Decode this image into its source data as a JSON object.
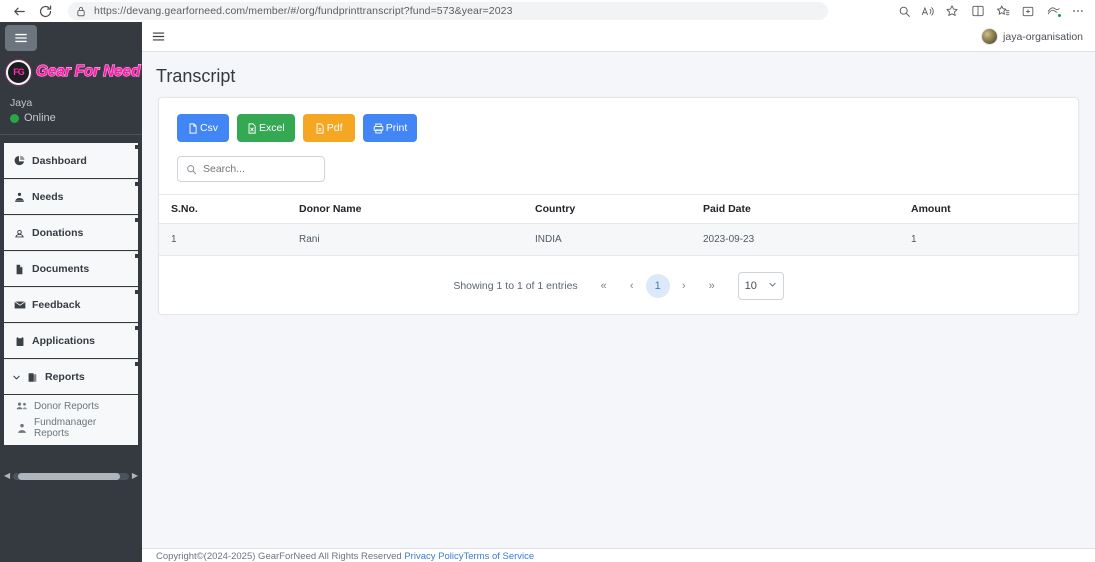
{
  "browser": {
    "url": "https://devang.gearforneed.com/member/#/org/fundprinttranscript?fund=573&year=2023",
    "back_label": "Back",
    "reload_label": "Refresh",
    "lock_label": "Site information",
    "icons": {
      "search": "search-icon",
      "read_aloud": "read-aloud-icon",
      "favorite": "favorite-star-icon",
      "split_screen": "split-screen-icon",
      "favorites_bar": "favorites-icon",
      "collections": "collections-icon",
      "browser_essentials": "browser-essentials-icon",
      "settings_more": "more-options-icon"
    }
  },
  "sidebar": {
    "toggle_label": "Toggle navigation",
    "brand": {
      "badge_text": "FG",
      "name": "Gear For Need"
    },
    "user": {
      "name": "Jaya",
      "status": "Online"
    },
    "items": [
      {
        "label": "Dashboard",
        "icon": "dashboard-pie-icon"
      },
      {
        "label": "Needs",
        "icon": "needs-hand-icon"
      },
      {
        "label": "Donations",
        "icon": "donations-icon"
      },
      {
        "label": "Documents",
        "icon": "document-icon"
      },
      {
        "label": "Feedback",
        "icon": "envelope-icon"
      },
      {
        "label": "Applications",
        "icon": "clipboard-icon"
      },
      {
        "label": "Reports",
        "icon": "reports-book-icon"
      }
    ],
    "reports_sub_items": [
      {
        "label": "Donor Reports",
        "icon": "users-group-icon"
      },
      {
        "label": "Fundmanager Reports",
        "icon": "user-tie-icon"
      }
    ]
  },
  "topbar": {
    "menu_label": "Menu",
    "org_name": "jaya-organisation"
  },
  "page": {
    "title": "Transcript"
  },
  "export_buttons": [
    {
      "label": "Csv",
      "color": "#4285f4",
      "icon": "file-csv-icon"
    },
    {
      "label": "Excel",
      "color": "#34a853",
      "icon": "file-excel-icon"
    },
    {
      "label": "Pdf",
      "color": "#f5a623",
      "icon": "file-pdf-icon"
    },
    {
      "label": "Print",
      "color": "#4285f4",
      "icon": "printer-icon"
    }
  ],
  "search": {
    "placeholder": "Search...",
    "value": "",
    "icon": "search-icon"
  },
  "table": {
    "columns": [
      "S.No.",
      "Donor Name",
      "Country",
      "Paid Date",
      "Amount"
    ],
    "rows": [
      [
        "1",
        "Rani",
        "INDIA",
        "2023-09-23",
        "1"
      ]
    ]
  },
  "pagination": {
    "info": "Showing 1 to 1 of 1 entries",
    "first": "«",
    "prev": "‹",
    "current_page": "1",
    "next": "›",
    "last": "»",
    "page_size": "10"
  },
  "footer": {
    "copyright": "Copyright©(2024-2025) GearForNeed All Rights Reserved",
    "privacy_link": "Privacy Policy",
    "terms_link": "Terms of Service"
  },
  "colors": {
    "sidebar_bg": "#343a40",
    "page_bg": "#f4f6f9",
    "brand_pink": "#ff1fae",
    "accent_blue": "#4285f4",
    "online_green": "#28a745"
  }
}
